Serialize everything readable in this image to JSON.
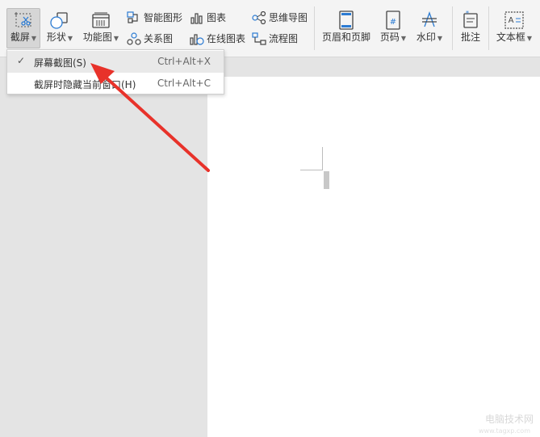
{
  "ribbon": {
    "screenshot_label": "截屏",
    "shapes_label": "形状",
    "function_chart_label": "功能图",
    "smart_graphic_label": "智能图形",
    "chart_label": "图表",
    "mindmap_label": "思维导图",
    "relation_chart_label": "关系图",
    "online_chart_label": "在线图表",
    "flowchart_label": "流程图",
    "header_footer_label": "页眉和页脚",
    "page_number_label": "页码",
    "watermark_label": "水印",
    "comment_label": "批注",
    "textbox_label": "文本框"
  },
  "screenshot_menu": {
    "items": [
      {
        "label": "屏幕截图(S)",
        "shortcut": "Ctrl+Alt+X",
        "checked": true
      },
      {
        "label": "截屏时隐藏当前窗口(H)",
        "shortcut": "Ctrl+Alt+C",
        "checked": false
      }
    ],
    "check_mark": "✓"
  },
  "watermark": {
    "text": "电脑技术网",
    "subtext": "www.tagxp.com"
  },
  "colors": {
    "annotation_arrow": "#e8322a",
    "ribbon_bg": "#f4f4f4",
    "page_bg": "#ffffff",
    "workspace_bg": "#e4e4e4"
  }
}
